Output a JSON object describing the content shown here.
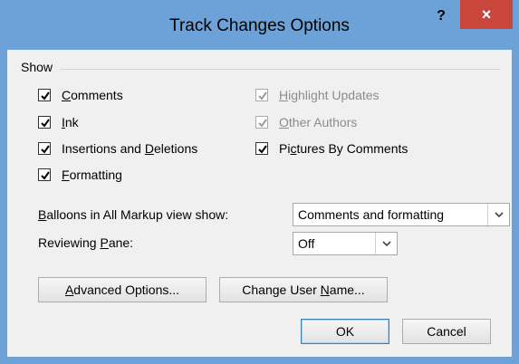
{
  "window": {
    "title": "Track Changes Options",
    "help_label": "?",
    "close_label": "×"
  },
  "show_group": {
    "label": "Show"
  },
  "checkboxes": {
    "comments": {
      "pre": "",
      "key": "C",
      "post": "omments",
      "checked": true,
      "enabled": true
    },
    "ink": {
      "pre": "",
      "key": "I",
      "post": "nk",
      "checked": true,
      "enabled": true
    },
    "insertions": {
      "pre": "Insertions and ",
      "key": "D",
      "post": "eletions",
      "checked": true,
      "enabled": true
    },
    "formatting": {
      "pre": "",
      "key": "F",
      "post": "ormatting",
      "checked": true,
      "enabled": true
    },
    "highlight": {
      "pre": "",
      "key": "H",
      "post": "ighlight Updates",
      "checked": true,
      "enabled": false
    },
    "other_authors": {
      "pre": "",
      "key": "O",
      "post": "ther Authors",
      "checked": true,
      "enabled": false
    },
    "pictures": {
      "pre": "Pi",
      "key": "c",
      "post": "tures By Comments",
      "checked": true,
      "enabled": true
    }
  },
  "balloons": {
    "label_key": "B",
    "label_rest": "alloons in All Markup view show:",
    "value": "Comments and formatting"
  },
  "reviewing_pane": {
    "label_pre": "Reviewing ",
    "label_key": "P",
    "label_post": "ane:",
    "value": "Off"
  },
  "buttons": {
    "advanced_key": "A",
    "advanced_rest": "dvanced Options...",
    "change_user_pre": "Change User ",
    "change_user_key": "N",
    "change_user_post": "ame...",
    "ok": "OK",
    "cancel": "Cancel"
  }
}
